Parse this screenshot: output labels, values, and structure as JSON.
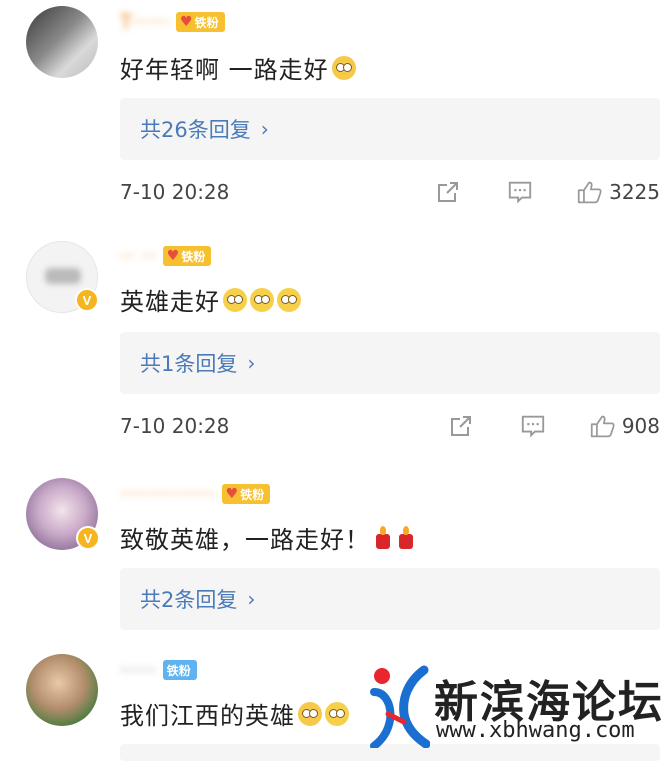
{
  "comments": [
    {
      "username": "T·····",
      "fan_badge": "铁粉",
      "text": "好年轻啊 一路走好",
      "replies": "共26条回复",
      "time": "7-10 20:28",
      "likes": "3225",
      "emojis": [
        "crying-face"
      ]
    },
    {
      "username": "·· ··",
      "fan_badge": "铁粉",
      "text": "英雄走好",
      "replies": "共1条回复",
      "time": "7-10 20:28",
      "likes": "908",
      "emojis": [
        "sad-face",
        "sad-face",
        "sad-face"
      ],
      "verified": "V"
    },
    {
      "username": "·············",
      "fan_badge": "铁粉",
      "text": "致敬英雄，一路走好！",
      "replies": "共2条回复",
      "emojis": [
        "candle",
        "candle"
      ],
      "verified": "V"
    },
    {
      "username": "·····",
      "fan_badge": "铁粉",
      "text": "我们江西的英雄",
      "emojis": [
        "crying-face",
        "sad-face"
      ]
    }
  ],
  "watermark": {
    "title": "新滨海论坛",
    "url": "www.xbhwang.com"
  },
  "colors": {
    "username": "#f08b20",
    "reply_link": "#4a7ab8",
    "fan_badge": "#f6c031",
    "verified_badge": "#f6b51e"
  },
  "icons": {
    "repost": "share-icon",
    "comment": "comment-icon",
    "like": "thumbs-up-icon"
  }
}
